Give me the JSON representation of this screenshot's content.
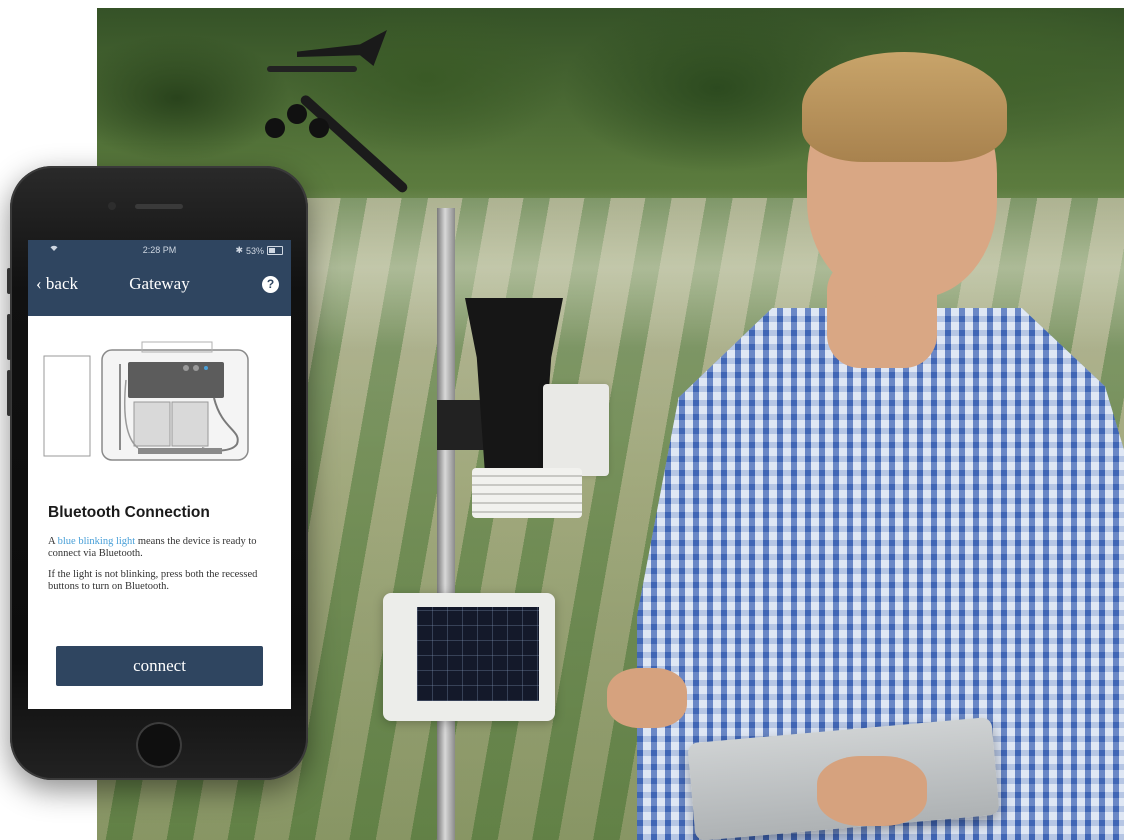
{
  "status_bar": {
    "time": "2:28 PM",
    "battery_percent": "53%",
    "battery_level": 0.53,
    "wifi_icon": "wifi-icon",
    "bluetooth_icon": "bluetooth-icon",
    "bluetooth_glyph": "✱"
  },
  "nav": {
    "back_chevron": "‹",
    "back_label": "back",
    "title": "Gateway",
    "help_label": "?"
  },
  "section": {
    "title": "Bluetooth Connection",
    "para1_prefix": "A ",
    "para1_highlight": "blue blinking light",
    "para1_suffix": " means the device is ready to connect via Bluetooth.",
    "para2": "If the light is not blinking, press both the recessed buttons to turn on Bluetooth."
  },
  "actions": {
    "connect_label": "connect"
  },
  "colors": {
    "header": "#2f4560",
    "highlight": "#4aa0d8",
    "button": "#2f4560"
  }
}
